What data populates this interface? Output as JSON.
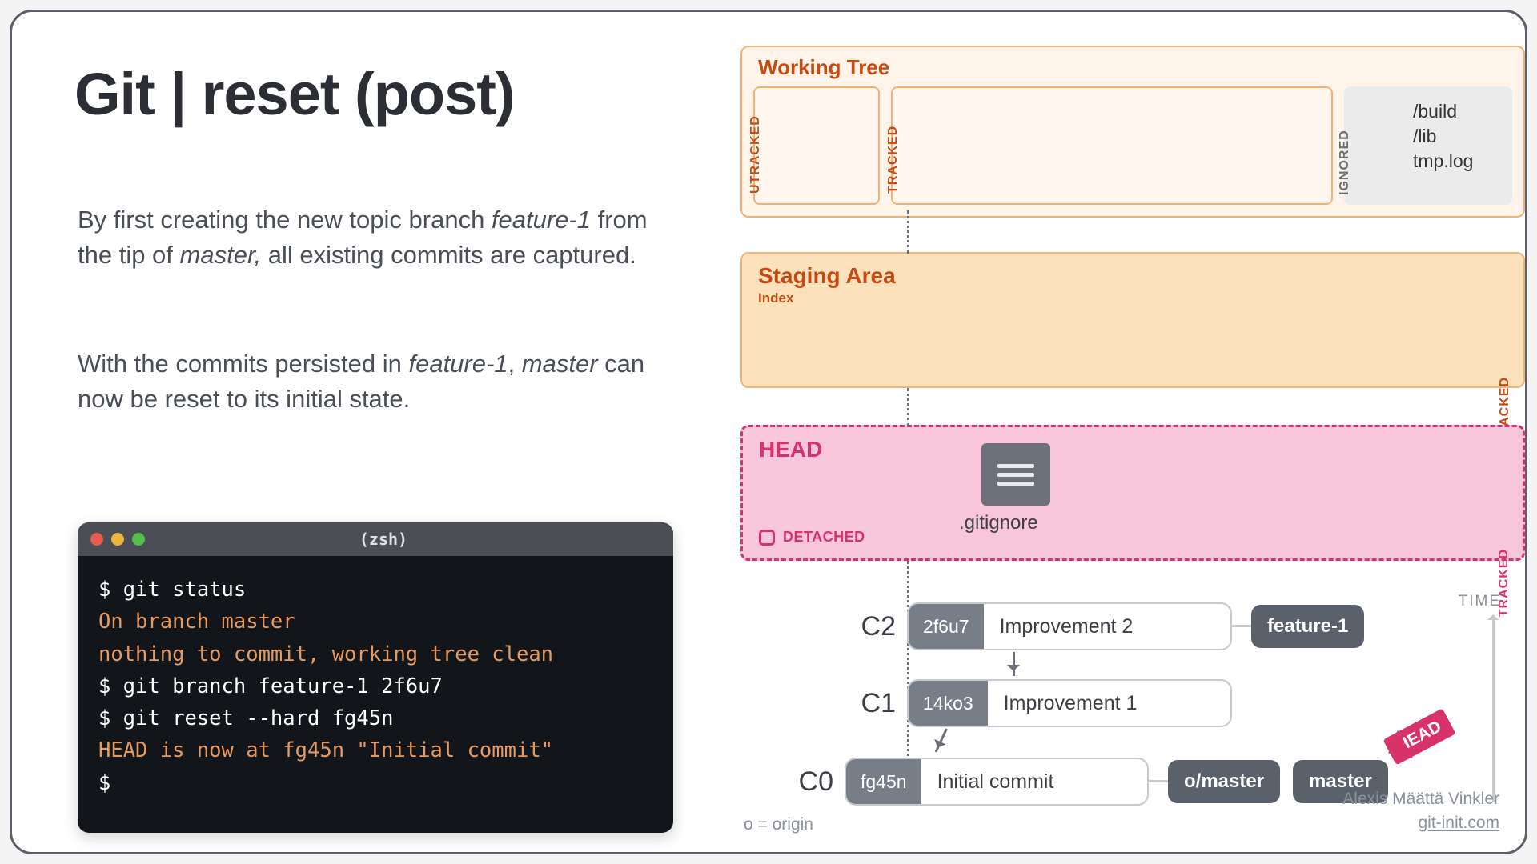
{
  "title": "Git | reset (post)",
  "paragraphs": {
    "p1_a": "By first creating the new topic branch ",
    "p1_em1": "feature-1",
    "p1_b": " from the tip of ",
    "p1_em2": "master,",
    "p1_c": " all existing commits are captured.",
    "p2_a": "With the commits persisted in ",
    "p2_em1": "feature-1",
    "p2_b": ", ",
    "p2_em2": "master",
    "p2_c": " can now be reset to its initial state."
  },
  "terminal": {
    "title": "(zsh)",
    "lines": [
      {
        "cls": "cmd",
        "text": "$ git status"
      },
      {
        "cls": "warn",
        "text": "On branch master"
      },
      {
        "cls": "warn",
        "text": "nothing to commit, working tree clean"
      },
      {
        "cls": "cmd",
        "text": "$ git branch feature-1 2f6u7"
      },
      {
        "cls": "cmd",
        "text": "$ git reset --hard fg45n"
      },
      {
        "cls": "warn",
        "text": "HEAD is now at fg45n \"Initial commit\""
      },
      {
        "cls": "cmd",
        "text": "$"
      }
    ]
  },
  "working_tree": {
    "title": "Working Tree",
    "utracked": "UTRACKED",
    "tracked": "TRACKED",
    "ignored_label": "IGNORED",
    "ignored_files": [
      "/build",
      "/lib",
      "tmp.log"
    ]
  },
  "staging": {
    "title": "Staging Area",
    "subtitle": "Index",
    "tracked": "TRACKED"
  },
  "head": {
    "title": "HEAD",
    "detached": "DETACHED",
    "file": ".gitignore",
    "tracked": "TRACKED"
  },
  "commits": {
    "c2": {
      "n": "C2",
      "sha": "2f6u7",
      "msg": "Improvement 2",
      "branch": "feature-1"
    },
    "c1": {
      "n": "C1",
      "sha": "14ko3",
      "msg": "Improvement 1"
    },
    "c0": {
      "n": "C0",
      "sha": "fg45n",
      "msg": "Initial commit",
      "remote": "o/master",
      "branch": "master"
    }
  },
  "time_label": "TIME",
  "head_pointer": "HEAD",
  "origin_note": "o = origin",
  "credit": {
    "name": "Alexis Määttä Vinkler",
    "site": "git-init.com"
  }
}
